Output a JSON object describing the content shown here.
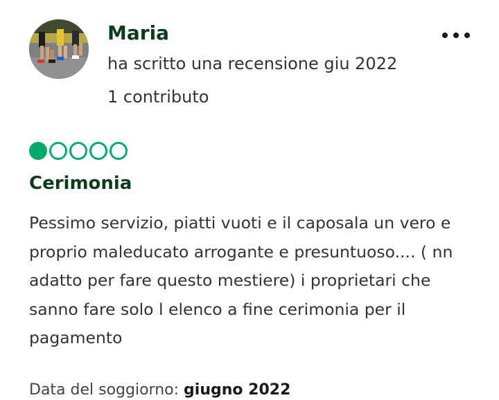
{
  "review": {
    "author": {
      "name": "Maria",
      "subtitle": "ha scritto una recensione giu 2022",
      "contributions": "1 contributo",
      "avatar_icon": "runners-photo"
    },
    "more_icon": "more-options-icon",
    "rating": {
      "value": 1,
      "max": 5,
      "color": "#00aa6c"
    },
    "title": "Cerimonia",
    "body": "Pessimo servizio, piatti vuoti e il caposala un vero e proprio maleducato arrogante e presuntuoso.... ( nn adatto per fare questo mestiere) i proprietari che sanno fare solo l elenco a fine cerimonia per il pagamento",
    "stay_date": {
      "label": "Data del soggiorno:",
      "value": "giugno 2022"
    }
  },
  "colors": {
    "title": "#0b3b1f",
    "bubble": "#00aa6c",
    "text": "#333333"
  }
}
